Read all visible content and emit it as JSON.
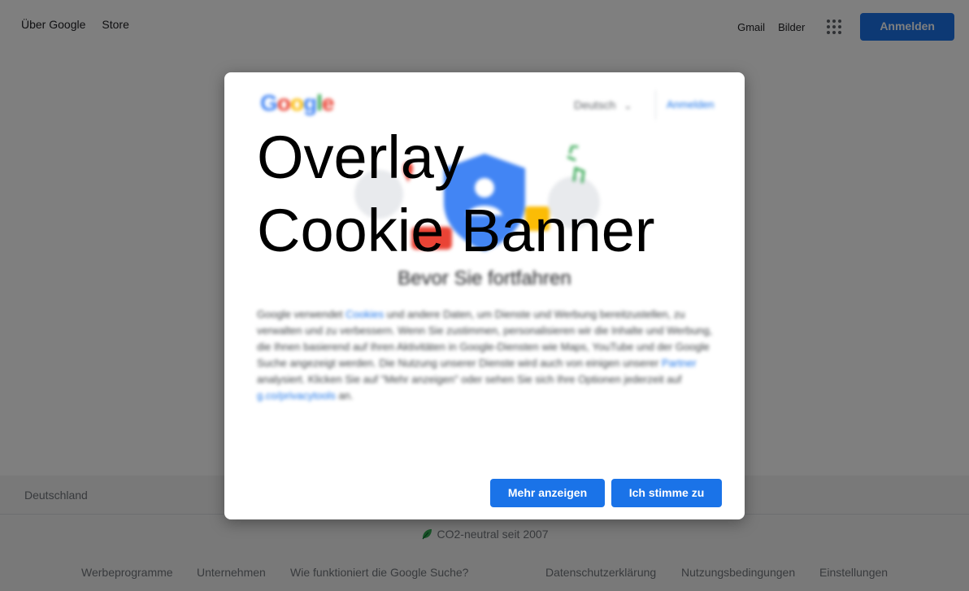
{
  "header": {
    "about_label": "Über Google",
    "store_label": "Store",
    "gmail_label": "Gmail",
    "images_label": "Bilder",
    "signin_label": "Anmelden"
  },
  "footer": {
    "country": "Deutschland",
    "carbon_text": "CO2-neutral seit 2007",
    "links_left": [
      "Werbeprogramme",
      "Unternehmen",
      "Wie funktioniert die Google Suche?"
    ],
    "links_right": [
      "Datenschutzerklärung",
      "Nutzungsbedingungen",
      "Einstellungen"
    ]
  },
  "dialog": {
    "logo": {
      "G": "G",
      "o1": "o",
      "o2": "o",
      "g": "g",
      "l": "l",
      "e": "e"
    },
    "language": "Deutsch",
    "signin_label": "Anmelden",
    "heading": "Bevor Sie fortfahren",
    "body": {
      "p1": "Google verwendet ",
      "cookies_link": "Cookies",
      "p2": " und andere Daten, um Dienste und Werbung bereitzustellen, zu verwalten und zu verbessern. Wenn Sie zustimmen, personalisieren wir die Inhalte und Werbung, die Ihnen basierend auf Ihren Aktivitäten in Google-Diensten wie Maps, YouTube und der Google Suche angezeigt werden. Die Nutzung unserer Dienste wird auch von einigen unserer ",
      "partner_link": "Partner",
      "p3": " analysiert. Klicken Sie auf \"Mehr anzeigen\" oder sehen Sie sich Ihre Optionen jederzeit auf ",
      "privacy_link": "g.co/privacytools",
      "p4": " an."
    },
    "overlay_line1": "Overlay",
    "overlay_line2": "Cookie Banner",
    "more_button": "Mehr anzeigen",
    "agree_button": "Ich stimme zu"
  },
  "colors": {
    "accent": "#1a73e8",
    "dimmer": "rgba(0,0,0,0.5)"
  }
}
